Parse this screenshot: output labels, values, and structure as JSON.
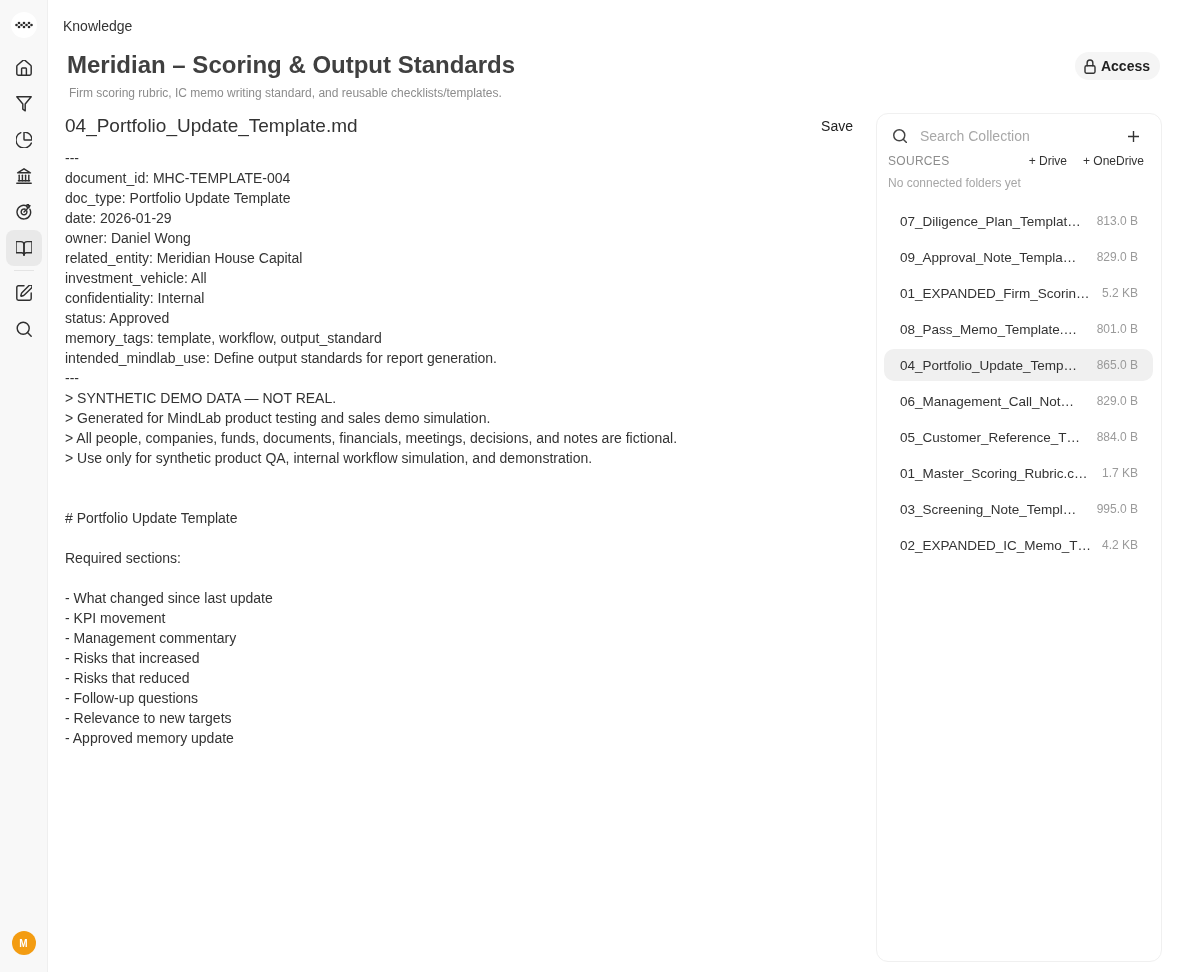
{
  "sidebar": {
    "nav_groups": [
      {
        "items": [
          {
            "kind": "home",
            "selected": false
          },
          {
            "kind": "filter",
            "selected": false
          },
          {
            "kind": "pie",
            "selected": false
          },
          {
            "kind": "bank",
            "selected": false
          },
          {
            "kind": "target",
            "selected": false
          },
          {
            "kind": "book",
            "selected": true
          }
        ]
      },
      {
        "items": [
          {
            "kind": "edit",
            "selected": false
          },
          {
            "kind": "search",
            "selected": false
          }
        ]
      }
    ],
    "avatar": {
      "initial": "M"
    }
  },
  "breadcrumb": "Knowledge",
  "header": {
    "title": "Meridian – Scoring & Output Standards",
    "subtitle": "Firm scoring rubric, IC memo writing standard, and reusable checklists/templates.",
    "access_button": "Access"
  },
  "editor": {
    "filename": "04_Portfolio_Update_Template.md",
    "save_button": "Save",
    "content": "---\ndocument_id: MHC-TEMPLATE-004\ndoc_type: Portfolio Update Template\ndate: 2026-01-29\nowner: Daniel Wong\nrelated_entity: Meridian House Capital\ninvestment_vehicle: All\nconfidentiality: Internal\nstatus: Approved\nmemory_tags: template, workflow, output_standard\nintended_mindlab_use: Define output standards for report generation.\n---\n> SYNTHETIC DEMO DATA — NOT REAL.\n> Generated for MindLab product testing and sales demo simulation.\n> All people, companies, funds, documents, financials, meetings, decisions, and notes are fictional.\n> Use only for synthetic product QA, internal workflow simulation, and demonstration.\n\n\n# Portfolio Update Template\n\nRequired sections:\n\n- What changed since last update\n- KPI movement\n- Management commentary\n- Risks that increased\n- Risks that reduced\n- Follow-up questions\n- Relevance to new targets\n- Approved memory update"
  },
  "collection": {
    "search": {
      "placeholder": "Search Collection"
    },
    "sources": {
      "label": "SOURCES",
      "buttons": [
        "+ Drive",
        "+ OneDrive"
      ],
      "empty_text": "No connected folders yet"
    },
    "files": [
      {
        "name": "07_Diligence_Plan_Templat…",
        "size": "813.0 B",
        "selected": false
      },
      {
        "name": "09_Approval_Note_Templa…",
        "size": "829.0 B",
        "selected": false
      },
      {
        "name": "01_EXPANDED_Firm_Scorin…",
        "size": "5.2 KB",
        "selected": false
      },
      {
        "name": "08_Pass_Memo_Template.…",
        "size": "801.0 B",
        "selected": false
      },
      {
        "name": "04_Portfolio_Update_Temp…",
        "size": "865.0 B",
        "selected": true
      },
      {
        "name": "06_Management_Call_Not…",
        "size": "829.0 B",
        "selected": false
      },
      {
        "name": "05_Customer_Reference_T…",
        "size": "884.0 B",
        "selected": false
      },
      {
        "name": "01_Master_Scoring_Rubric.c…",
        "size": "1.7 KB",
        "selected": false
      },
      {
        "name": "03_Screening_Note_Templ…",
        "size": "995.0 B",
        "selected": false
      },
      {
        "name": "02_EXPANDED_IC_Memo_T…",
        "size": "4.2 KB",
        "selected": false
      }
    ]
  }
}
